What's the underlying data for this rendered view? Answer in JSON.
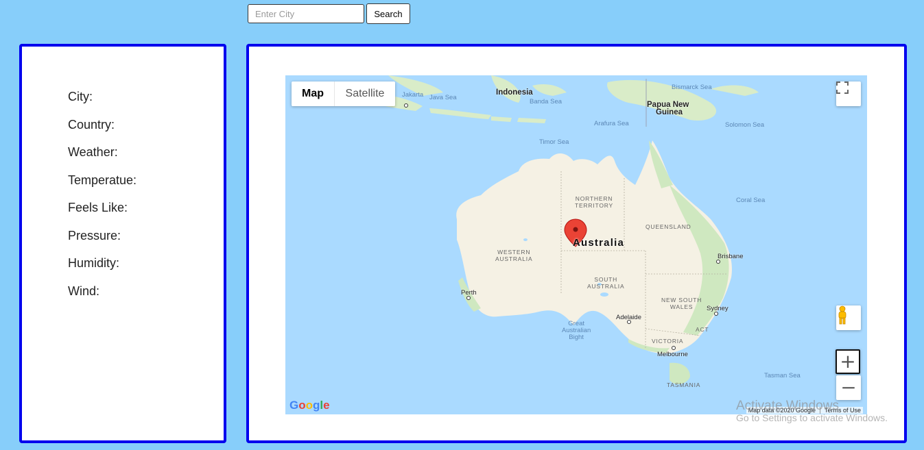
{
  "search": {
    "placeholder": "Enter City",
    "button_label": "Search"
  },
  "weather": {
    "labels": [
      "City:",
      "Country:",
      "Weather:",
      "Temperatue:",
      "Feels Like:",
      "Pressure:",
      "Humidity:",
      "Wind:"
    ]
  },
  "map": {
    "type_control": {
      "map": "Map",
      "satellite": "Satellite"
    },
    "zoom_in": "+",
    "zoom_out": "−",
    "logo": [
      "G",
      "o",
      "o",
      "g",
      "l",
      "e"
    ],
    "logo_colors": [
      "#4285f4",
      "#ea4335",
      "#fbbc05",
      "#4285f4",
      "#34a853",
      "#ea4335"
    ],
    "attribution": {
      "data": "Map data ©2020 Google",
      "terms": "Terms of Use"
    },
    "labels": {
      "jakarta": "Jakarta",
      "java_sea": "Java Sea",
      "indonesia": "Indonesia",
      "banda_sea": "Banda Sea",
      "bismarck_sea": "Bismarck Sea",
      "png_1": "Papua New",
      "png_2": "Guinea",
      "arafura_sea": "Arafura Sea",
      "solomon_sea": "Solomon Sea",
      "timor_sea": "Timor Sea",
      "nt_1": "NORTHERN",
      "nt_2": "TERRITORY",
      "coral_sea": "Coral Sea",
      "queensland": "QUEENSLAND",
      "australia": "Australia",
      "wa_1": "WESTERN",
      "wa_2": "AUSTRALIA",
      "brisbane": "Brisbane",
      "sa_1": "SOUTH",
      "sa_2": "AUSTRALIA",
      "perth": "Perth",
      "nsw_1": "NEW SOUTH",
      "nsw_2": "WALES",
      "sydney": "Sydney",
      "adelaide": "Adelaide",
      "act": "ACT",
      "gab_1": "Great",
      "gab_2": "Australian",
      "gab_3": "Bight",
      "victoria": "VICTORIA",
      "melbourne": "Melbourne",
      "tasman_sea": "Tasman Sea",
      "tasmania": "TASMANIA"
    },
    "colors": {
      "water": "#aadaff",
      "land": "#f5f1e4",
      "green": "#cfe8c0",
      "marker": "#ea4335"
    }
  },
  "watermark": {
    "line1": "Activate Windows",
    "line2": "Go to Settings to activate Windows."
  }
}
